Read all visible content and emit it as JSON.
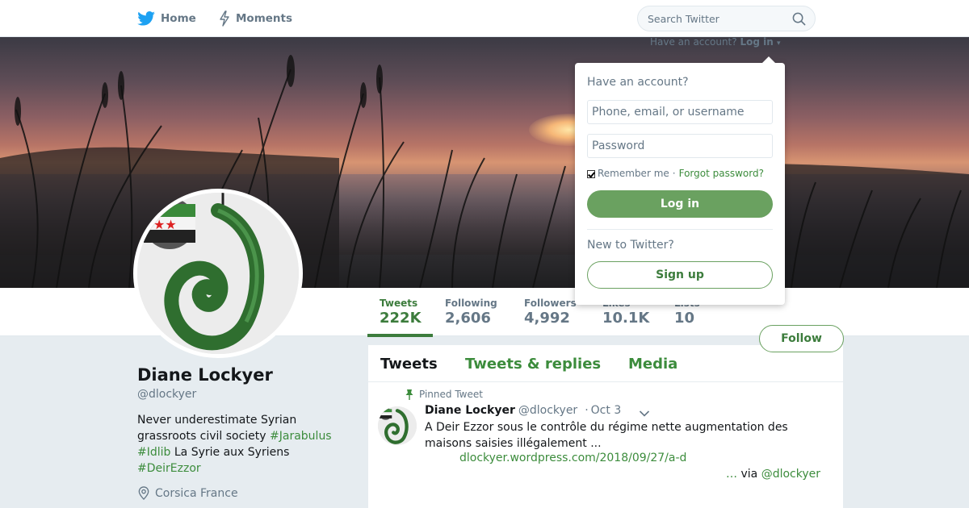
{
  "nav": {
    "home_label": "Home",
    "moments_label": "Moments",
    "search_placeholder": "Search Twitter"
  },
  "login_hint": {
    "text": "Have an account?",
    "link": "Log in"
  },
  "login_dropdown": {
    "title": "Have an account?",
    "username_placeholder": "Phone, email, or username",
    "password_placeholder": "Password",
    "remember_label": "Remember me",
    "separator": "·",
    "forgot_label": "Forgot password?",
    "login_button": "Log in",
    "new_label": "New to Twitter?",
    "signup_button": "Sign up"
  },
  "stats": [
    {
      "label": "Tweets",
      "value": "222K"
    },
    {
      "label": "Following",
      "value": "2,606"
    },
    {
      "label": "Followers",
      "value": "4,992"
    },
    {
      "label": "Likes",
      "value": "10.1K"
    },
    {
      "label": "Lists",
      "value": "10"
    }
  ],
  "follow_button": "Follow",
  "profile": {
    "name": "Diane Lockyer",
    "handle": "@dlockyer",
    "bio_text_1": "Never underestimate Syrian grassroots civil society ",
    "bio_tag_1": "#Jarabulus",
    "bio_tag_2": "#Idlib",
    "bio_text_2": " La Syrie aux Syriens ",
    "bio_tag_3": "#DeirEzzor",
    "location": "Corsica France"
  },
  "timeline": {
    "tabs": [
      "Tweets",
      "Tweets & replies",
      "Media"
    ],
    "pinned_label": "Pinned Tweet",
    "tweet": {
      "name": "Diane Lockyer",
      "handle": "@dlockyer",
      "dot": "·",
      "date": "Oct 3",
      "text": "A Deir Ezzor sous le contrôle du régime nette augmentation des maisons saisies illégalement ...",
      "link": "dlockyer.wordpress.com/2018/09/27/a-d",
      "via_ellipsis": "…",
      "via_text": " via ",
      "via_handle": "@dlockyer"
    }
  },
  "colors": {
    "accent": "#3c8c3c",
    "button_fill": "#6aa160",
    "secondary_text": "#657786",
    "background": "#e6ecf0"
  },
  "icons": {
    "home": "twitter-bird-icon",
    "moments": "lightning-icon",
    "search": "search-icon",
    "pinned": "pin-icon",
    "location": "location-pin-icon",
    "tweet_menu": "chevron-down-icon"
  }
}
